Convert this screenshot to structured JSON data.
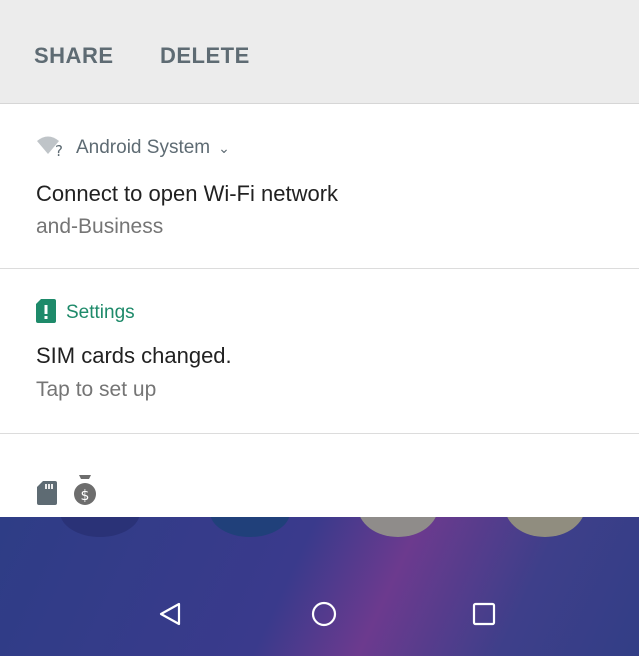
{
  "actions": {
    "share_label": "SHARE",
    "delete_label": "DELETE"
  },
  "notifications": [
    {
      "app": "Android System",
      "icon": "wifi-question-icon",
      "title": "Connect to open Wi-Fi network",
      "text": "and-Business",
      "accent": "#5e6b73"
    },
    {
      "app": "Settings",
      "icon": "sim-alert-icon",
      "title": "SIM cards changed.",
      "text": "Tap to set up",
      "accent": "#1e8a6a"
    }
  ],
  "overflow_icons": [
    "sd-card-icon",
    "money-bag-icon"
  ],
  "navbar": {
    "buttons": [
      "back-icon",
      "home-icon",
      "recents-icon"
    ]
  }
}
